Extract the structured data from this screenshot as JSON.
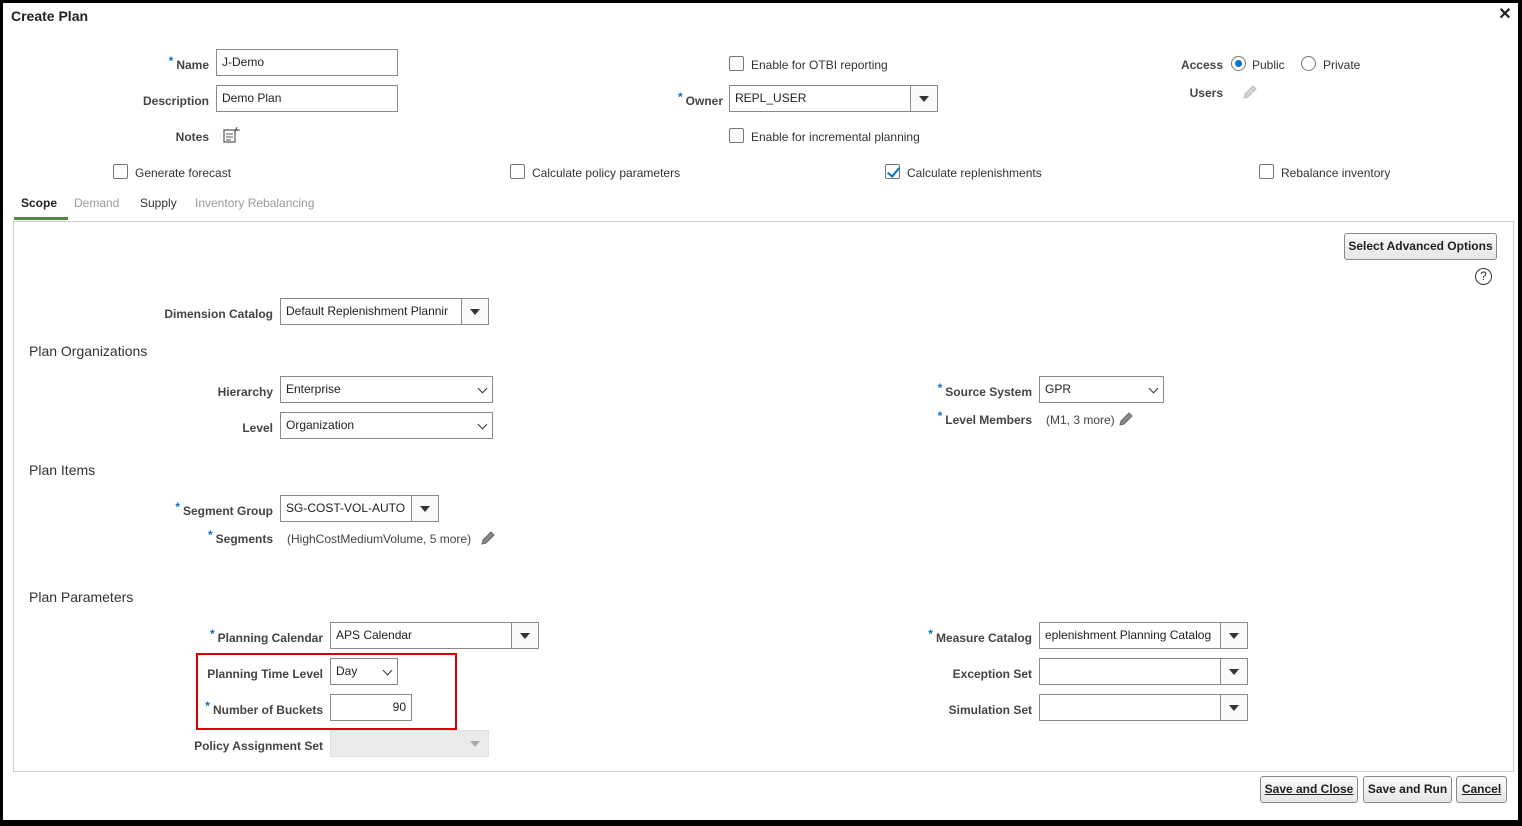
{
  "dialog": {
    "title": "Create Plan"
  },
  "header": {
    "name_label": "Name",
    "name_value": "J-Demo",
    "description_label": "Description",
    "description_value": "Demo Plan",
    "notes_label": "Notes",
    "otbi_label": "Enable for OTBI reporting",
    "otbi_checked": false,
    "owner_label": "Owner",
    "owner_value": "REPL_USER",
    "incremental_label": "Enable for incremental planning",
    "incremental_checked": false,
    "access_label": "Access",
    "access_public": "Public",
    "access_private": "Private",
    "access_selected": "Public",
    "users_label": "Users"
  },
  "options": {
    "generate_forecast": "Generate forecast",
    "generate_forecast_checked": false,
    "calc_policy": "Calculate policy parameters",
    "calc_policy_checked": false,
    "calc_replenishments": "Calculate replenishments",
    "calc_replenishments_checked": true,
    "rebalance": "Rebalance inventory",
    "rebalance_checked": false
  },
  "tabs": [
    {
      "label": "Scope",
      "state": "active"
    },
    {
      "label": "Demand",
      "state": "disabled"
    },
    {
      "label": "Supply",
      "state": "enabled"
    },
    {
      "label": "Inventory Rebalancing",
      "state": "disabled"
    }
  ],
  "scope": {
    "advanced_button": "Select Advanced Options",
    "help_glyph": "?",
    "dimension_catalog_label": "Dimension Catalog",
    "dimension_catalog_value": "Default Replenishment Plannir",
    "plan_orgs_heading": "Plan Organizations",
    "hierarchy_label": "Hierarchy",
    "hierarchy_value": "Enterprise",
    "level_label": "Level",
    "level_value": "Organization",
    "source_system_label": "Source System",
    "source_system_value": "GPR",
    "level_members_label": "Level Members",
    "level_members_value": "(M1, 3 more)",
    "plan_items_heading": "Plan Items",
    "segment_group_label": "Segment Group",
    "segment_group_value": "SG-COST-VOL-AUTO",
    "segments_label": "Segments",
    "segments_value": "(HighCostMediumVolume, 5 more)",
    "plan_params_heading": "Plan Parameters",
    "planning_calendar_label": "Planning Calendar",
    "planning_calendar_value": "APS Calendar",
    "planning_time_level_label": "Planning Time Level",
    "planning_time_level_value": "Day",
    "num_buckets_label": "Number of Buckets",
    "num_buckets_value": "90",
    "policy_set_label": "Policy Assignment Set",
    "policy_set_value": "",
    "measure_catalog_label": "Measure Catalog",
    "measure_catalog_value": "eplenishment Planning Catalog",
    "exception_set_label": "Exception Set",
    "exception_set_value": "",
    "simulation_set_label": "Simulation Set",
    "simulation_set_value": ""
  },
  "footer": {
    "save_close": "Save and Close",
    "save_run": "Save and Run",
    "cancel": "Cancel"
  },
  "colors": {
    "accent": "#0572ce",
    "active_tab_underline": "#4d8b3f",
    "highlight_box": "#e00000"
  }
}
